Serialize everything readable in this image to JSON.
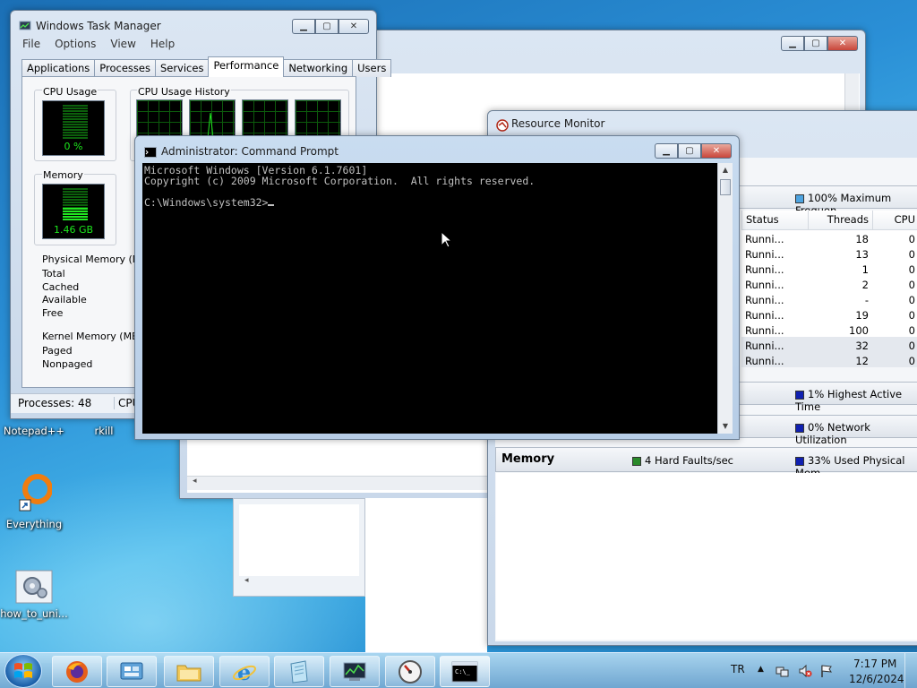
{
  "desktop": {
    "icons": [
      {
        "label": "Notepad++"
      },
      {
        "label": "rkill"
      },
      {
        "label": "Everything"
      },
      {
        "label": "how_to_uni..."
      }
    ]
  },
  "task_manager": {
    "title": "Windows Task Manager",
    "menu": [
      "File",
      "Options",
      "View",
      "Help"
    ],
    "tabs": [
      "Applications",
      "Processes",
      "Services",
      "Performance",
      "Networking",
      "Users"
    ],
    "active_tab": "Performance",
    "cpu_usage_label": "CPU Usage",
    "cpu_usage_value": "0 %",
    "cpu_history_label": "CPU Usage History",
    "memory_label": "Memory",
    "memory_value": "1.46 GB",
    "physical_memory_label": "Physical Memory (MB)",
    "physical_rows": [
      "Total",
      "Cached",
      "Available",
      "Free"
    ],
    "kernel_memory_label": "Kernel Memory (MB)",
    "kernel_rows": [
      "Paged",
      "Nonpaged"
    ],
    "status_processes": "Processes: 48",
    "status_cpu": "CPU"
  },
  "cmd": {
    "title": "Administrator: Command Prompt",
    "line1": "Microsoft Windows [Version 6.1.7601]",
    "line2": "Copyright (c) 2009 Microsoft Corporation.  All rights reserved.",
    "prompt": "C:\\Windows\\system32>"
  },
  "resource_monitor": {
    "title": "Resource Monitor",
    "cpu_summary": "100% Maximum Frequen",
    "columns": [
      "Status",
      "Threads",
      "CPU"
    ],
    "rows": [
      {
        "status": "Runni...",
        "threads": "18",
        "cpu": "0"
      },
      {
        "status": "Runni...",
        "threads": "13",
        "cpu": "0"
      },
      {
        "status": "Runni...",
        "threads": "1",
        "cpu": "0"
      },
      {
        "status": "Runni...",
        "threads": "2",
        "cpu": "0"
      },
      {
        "status": "Runni...",
        "threads": "-",
        "cpu": "0"
      },
      {
        "status": "Runni...",
        "threads": "19",
        "cpu": "0"
      },
      {
        "status": "Runni...",
        "threads": "100",
        "cpu": "0"
      },
      {
        "status": "Runni...",
        "threads": "32",
        "cpu": "0"
      },
      {
        "status": "Runni...",
        "threads": "12",
        "cpu": "0"
      }
    ],
    "disk_summary": "1% Highest Active Time",
    "network_summary": "0% Network Utilization",
    "memory_label": "Memory",
    "hard_faults": "4 Hard Faults/sec",
    "memory_used": "33% Used Physical Mem"
  },
  "taskbar": {
    "language": "TR",
    "time": "7:17 PM",
    "date": "12/6/2024"
  },
  "colors": {
    "accent_green": "#1de81d",
    "close_red": "#c9453a",
    "cpu_summary_square": "#4da3e0",
    "disk_summary_square": "#1020b0",
    "memory_faults_square": "#2a8a2a"
  }
}
